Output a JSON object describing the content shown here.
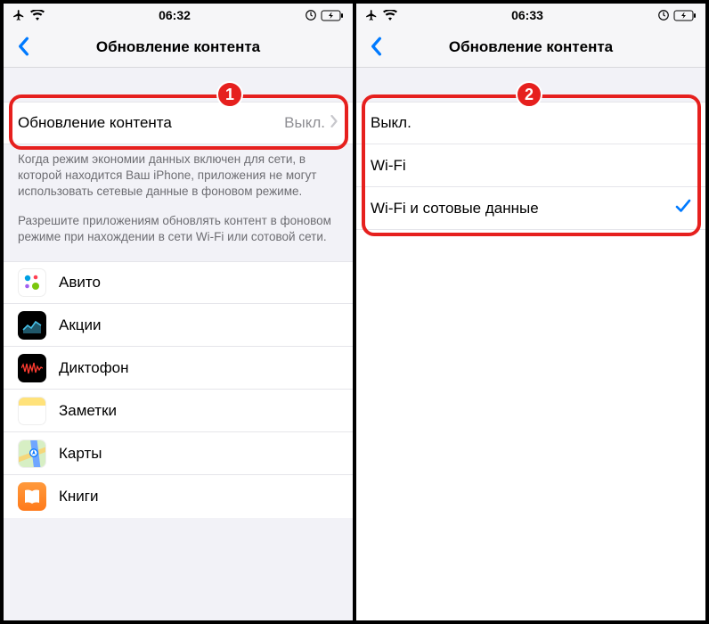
{
  "left": {
    "status": {
      "time": "06:32"
    },
    "nav": {
      "title": "Обновление контента"
    },
    "mainRow": {
      "label": "Обновление контента",
      "value": "Выкл."
    },
    "footer1": "Когда режим экономии данных включен для сети, в которой находится Ваш iPhone, приложения не могут использовать сетевые данные в фоновом режиме.",
    "footer2": "Разрешите приложениям обновлять контент в фоновом режиме при нахождении в сети Wi-Fi или сотовой сети.",
    "apps": [
      {
        "name": "Авито"
      },
      {
        "name": "Акции"
      },
      {
        "name": "Диктофон"
      },
      {
        "name": "Заметки"
      },
      {
        "name": "Карты"
      },
      {
        "name": "Книги"
      }
    ],
    "badge": "1"
  },
  "right": {
    "status": {
      "time": "06:33"
    },
    "nav": {
      "title": "Обновление контента"
    },
    "options": [
      {
        "label": "Выкл.",
        "selected": false
      },
      {
        "label": "Wi-Fi",
        "selected": false
      },
      {
        "label": "Wi-Fi и сотовые данные",
        "selected": true
      }
    ],
    "badge": "2"
  }
}
